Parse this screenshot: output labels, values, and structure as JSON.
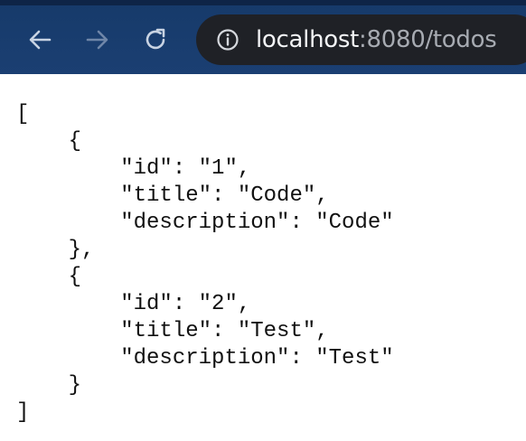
{
  "browser": {
    "url_host": "localhost",
    "url_rest": ":8080/todos",
    "icons": {
      "back": "arrow-left-icon",
      "forward": "arrow-right-icon",
      "reload": "reload-icon",
      "site_info": "info-circle-icon"
    },
    "colors": {
      "toolbar": "#1b3f72",
      "urlbar": "#1f2126"
    }
  },
  "content": {
    "lines": [
      "[",
      "    {",
      "        \"id\": \"1\",",
      "        \"title\": \"Code\",",
      "        \"description\": \"Code\"",
      "    },",
      "    {",
      "        \"id\": \"2\",",
      "        \"title\": \"Test\",",
      "        \"description\": \"Test\"",
      "    }",
      "]"
    ]
  }
}
